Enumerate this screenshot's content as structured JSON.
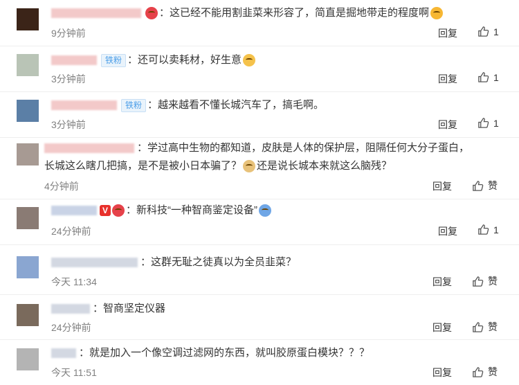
{
  "comments": [
    {
      "username_label": "",
      "text": "：这已经不能用割韭菜来形容了，简直是掘地带走的程度啊",
      "time": "9分钟前",
      "reply_label": "回复",
      "like_count": "1",
      "avatar_color": "#3b2418"
    },
    {
      "badge": "铁粉",
      "text": "：还可以卖耗材，好生意",
      "time": "3分钟前",
      "reply_label": "回复",
      "like_count": "1",
      "avatar_color": "#b9c4b6"
    },
    {
      "badge": "铁粉",
      "text": "：越来越看不懂长城汽车了，搞毛啊。",
      "time": "3分钟前",
      "reply_label": "回复",
      "like_count": "1",
      "avatar_color": "#5b7fa6"
    },
    {
      "text_line1": "：学过高中生物的都知道，皮肤是人体的保护层，阻隔任何大分子蛋白，",
      "text_line2a": "长城这么瞎几把搞，是不是被小日本骗了？",
      "text_line2b": "还是说长城本来就这么脑残？",
      "time": "4分钟前",
      "reply_label": "回复",
      "like_label": "赞",
      "avatar_color": "#a79a93"
    },
    {
      "badge_v": "V",
      "text": "：新科技“一种智商鉴定设备”",
      "time": "24分钟前",
      "reply_label": "回复",
      "like_count": "1",
      "avatar_color": "#8a7b74"
    },
    {
      "text": "：这群无耻之徒真以为全员韭菜？",
      "time": "今天 11:34",
      "reply_label": "回复",
      "like_label": "赞",
      "avatar_color": "#8aa6d1"
    },
    {
      "text": "：智商坚定仪器",
      "time": "24分钟前",
      "reply_label": "回复",
      "like_label": "赞",
      "avatar_color": "#7a6a5c"
    },
    {
      "text": "：就是加入一个像空调过滤网的东西，就叫胶原蛋白模块？？？",
      "time": "今天 11:51",
      "reply_label": "回复",
      "like_label": "赞",
      "avatar_color": "#b4b4b4"
    }
  ]
}
